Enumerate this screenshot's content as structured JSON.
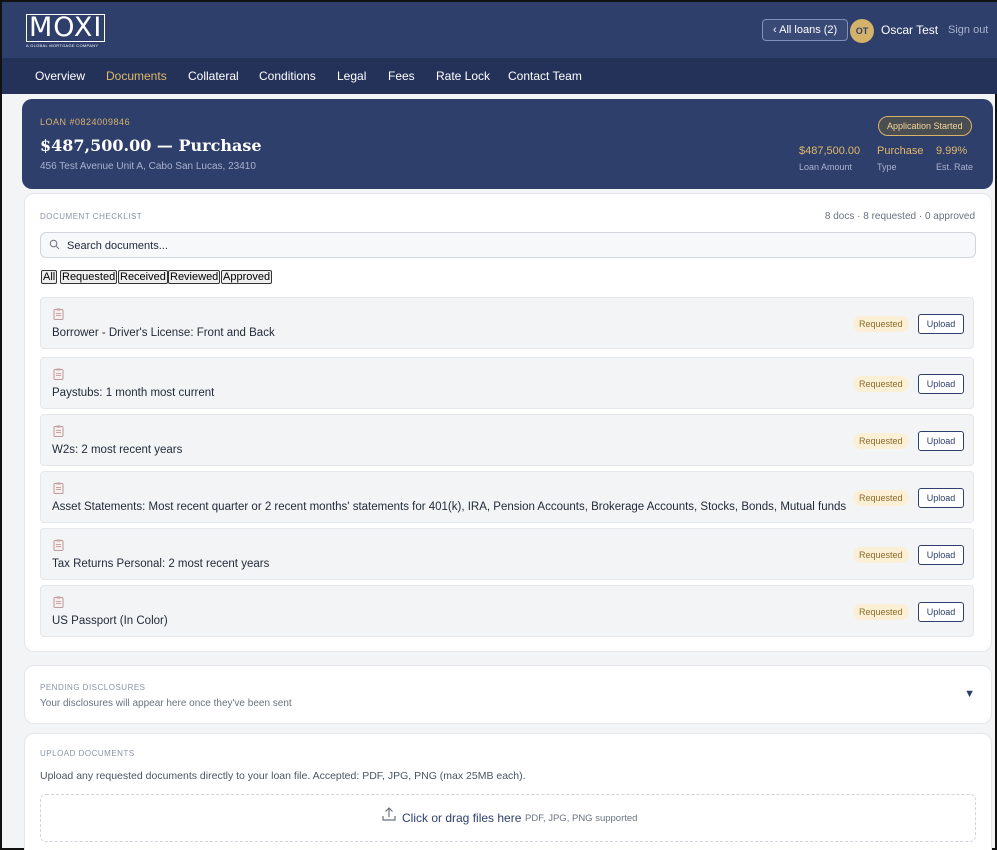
{
  "header": {
    "logo_text": "MOXI",
    "logo_subtext": "A GLOBAL MORTGAGE COMPANY",
    "all_loans_label": "‹ All loans (2)",
    "user_initials": "OT",
    "user_name": "Oscar Test",
    "sign_out_label": "Sign out"
  },
  "nav": {
    "items": [
      {
        "label": "Overview"
      },
      {
        "label": "Documents",
        "active": true
      },
      {
        "label": "Collateral"
      },
      {
        "label": "Conditions"
      },
      {
        "label": "Legal"
      },
      {
        "label": "Fees"
      },
      {
        "label": "Rate Lock"
      },
      {
        "label": "Contact Team"
      }
    ]
  },
  "loan": {
    "number": "LOAN #0824009846",
    "title": "$487,500.00 — Purchase",
    "address": "456 Test Avenue Unit A, Cabo San Lucas, 23410",
    "status": "Application Started",
    "stats": [
      {
        "value": "$487,500.00",
        "label": "Loan Amount"
      },
      {
        "value": "Purchase",
        "label": "Type"
      },
      {
        "value": "9.99%",
        "label": "Est. Rate"
      }
    ]
  },
  "checklist": {
    "title": "DOCUMENT CHECKLIST",
    "summary": "8 docs · 8 requested · 0 approved",
    "search_placeholder": "Search documents...",
    "filters": [
      {
        "label": "All"
      },
      {
        "label": "Requested"
      },
      {
        "label": "Received"
      },
      {
        "label": "Reviewed"
      },
      {
        "label": "Approved"
      }
    ],
    "documents": [
      {
        "name": "Borrower - Driver's License: Front and Back",
        "status": "Requested",
        "action": "Upload"
      },
      {
        "name": "Paystubs: 1 month most current",
        "status": "Requested",
        "action": "Upload"
      },
      {
        "name": "W2s: 2 most recent years",
        "status": "Requested",
        "action": "Upload"
      },
      {
        "name": "Asset Statements: Most recent quarter or 2 recent months' statements for 401(k), IRA, Pension Accounts, Brokerage Accounts, Stocks, Bonds, Mutual funds",
        "status": "Requested",
        "action": "Upload"
      },
      {
        "name": "Tax Returns Personal: 2 most recent years",
        "status": "Requested",
        "action": "Upload"
      },
      {
        "name": "US Passport (In Color)",
        "status": "Requested",
        "action": "Upload"
      }
    ]
  },
  "disclosures": {
    "title": "PENDING DISCLOSURES",
    "description": "Your disclosures will appear here once they've been sent",
    "toggle_icon": "chevron-down-icon",
    "toggle_glyph": "▼"
  },
  "upload": {
    "title": "UPLOAD DOCUMENTS",
    "description": "Upload any requested documents directly to your loan file. Accepted: PDF, JPG, PNG (max 25MB each).",
    "dropzone_label": "Click or drag files here",
    "dropzone_hint": "PDF, JPG, PNG supported"
  },
  "colors": {
    "primary": "#2f3f6b",
    "nav_bg": "#24325a",
    "accent": "#e0b968",
    "badge_bg": "#fbf0d6"
  }
}
